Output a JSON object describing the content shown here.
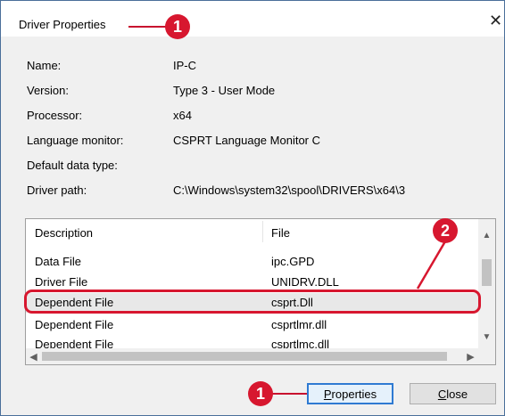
{
  "dialog": {
    "title": "Driver Properties",
    "close_glyph": "✕"
  },
  "annotations": {
    "badge1_title": "1",
    "badge2": "2",
    "badge1_button": "1",
    "color": "#d7172f"
  },
  "properties": [
    {
      "label": "Name:",
      "value": "IP-C"
    },
    {
      "label": "Version:",
      "value": "Type 3 - User Mode"
    },
    {
      "label": "Processor:",
      "value": "x64"
    },
    {
      "label": "Language monitor:",
      "value": "CSPRT Language Monitor C"
    },
    {
      "label": "Default data type:",
      "value": ""
    },
    {
      "label": "Driver path:",
      "value": "C:\\Windows\\system32\\spool\\DRIVERS\\x64\\3"
    }
  ],
  "file_list": {
    "columns": {
      "description": "Description",
      "file": "File"
    },
    "rows": [
      {
        "description": "Data File",
        "file": "ipc.GPD"
      },
      {
        "description": "Driver File",
        "file": "UNIDRV.DLL"
      },
      {
        "description": "Dependent File",
        "file": "csprt.Dll",
        "selected": true
      },
      {
        "description": "Dependent File",
        "file": "csprtlmr.dll"
      },
      {
        "description": "Dependent File",
        "file": "csprtlmc.dll"
      }
    ]
  },
  "scrollbar_glyphs": {
    "up": "▲",
    "down": "▼",
    "left": "◀",
    "right": "▶"
  },
  "buttons": {
    "properties": "Properties",
    "close": "Close"
  }
}
